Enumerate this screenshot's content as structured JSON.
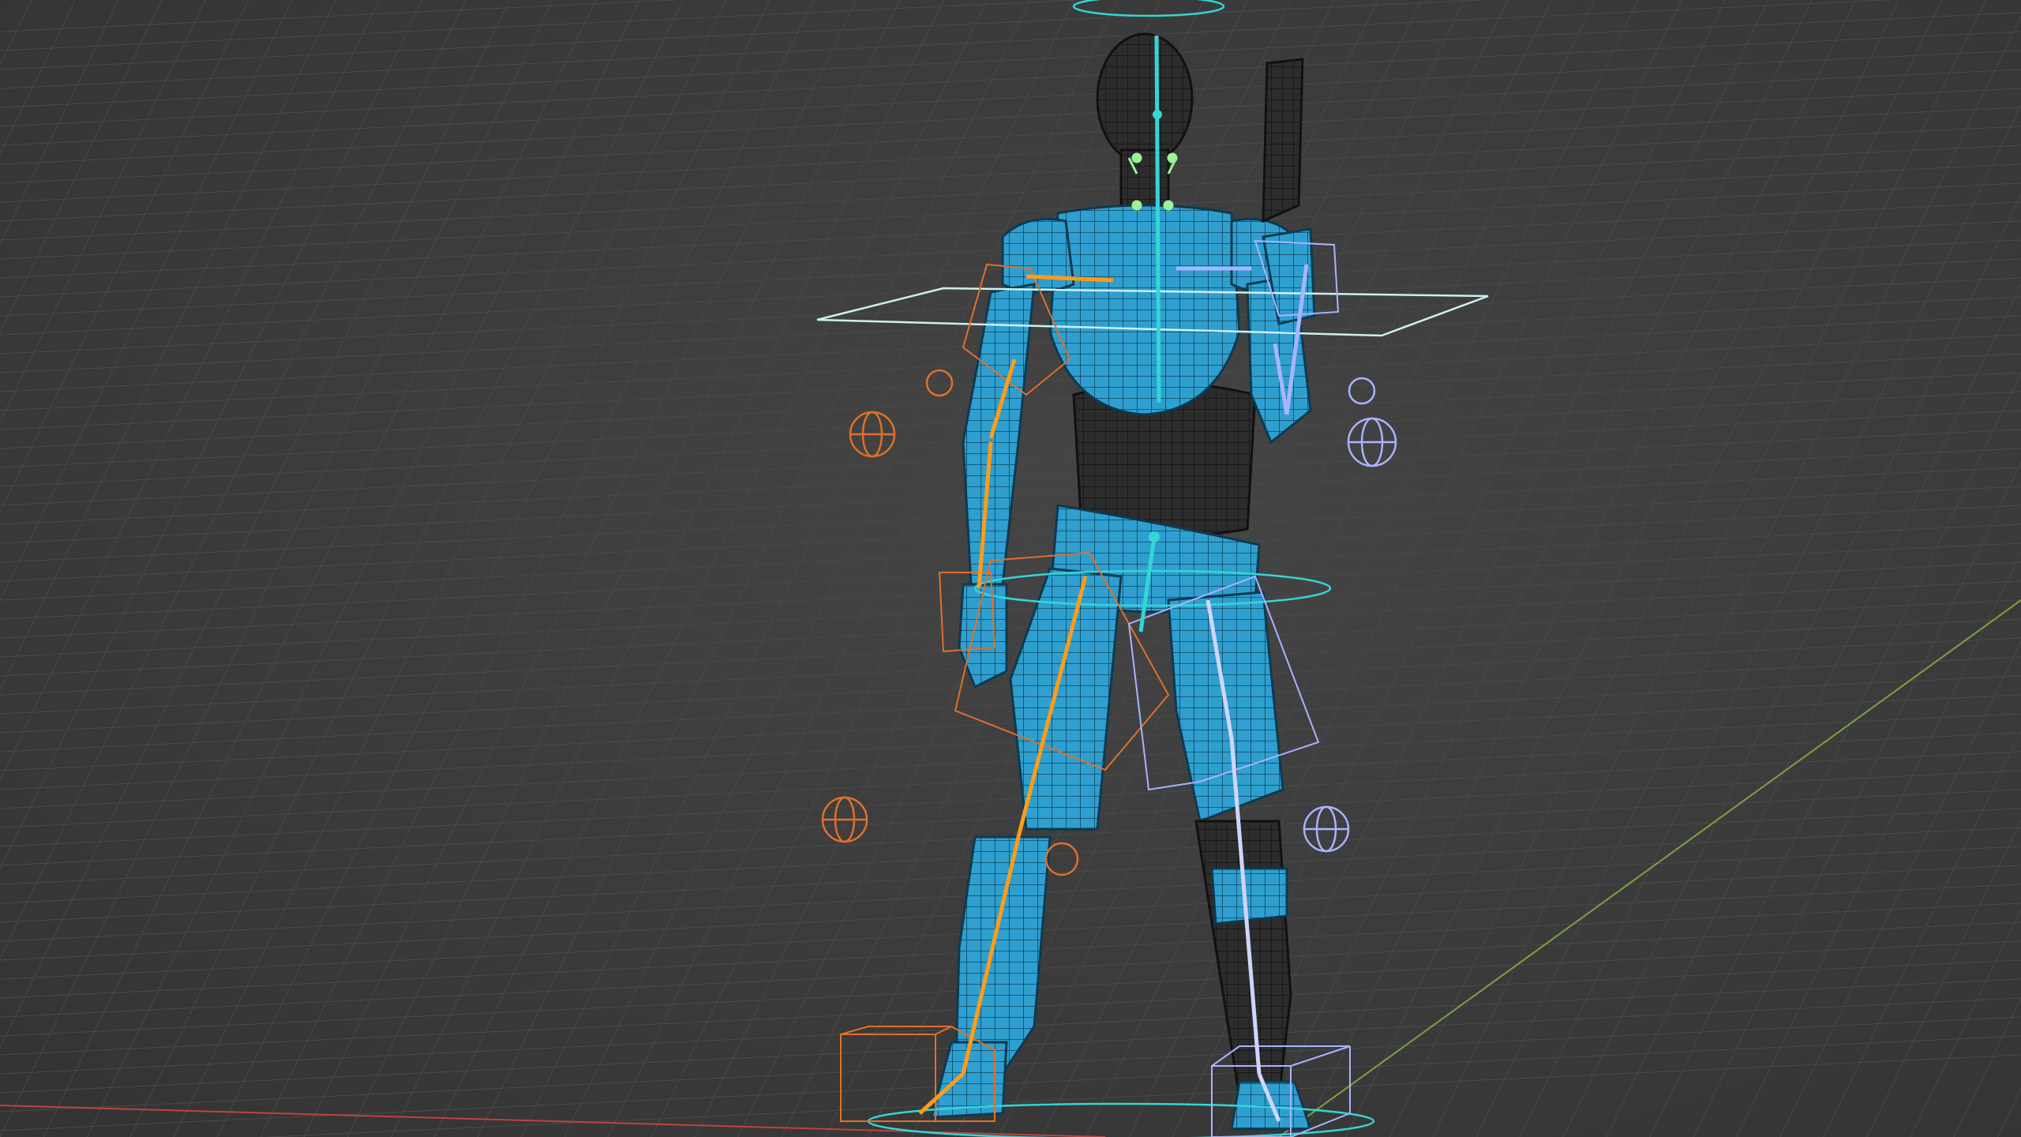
{
  "viewport": {
    "background": "#3a3a3a",
    "grid_color": "#4a4a4a",
    "axis_x_color": "#c0423f",
    "axis_y_color": "#7fa33a"
  },
  "model": {
    "mesh_color": "#2fa3d6",
    "body_color": "#2a2a2a"
  },
  "rig": {
    "center_bone_color": "#33d6d6",
    "left_side_color": "#e0702a",
    "right_side_color": "#a9b4ff",
    "bones": [
      "spine-bone",
      "neck-bone",
      "left-upper-arm-bone",
      "left-forearm-bone",
      "left-thigh-bone",
      "left-shin-bone",
      "right-upper-arm-bone",
      "right-forearm-bone",
      "right-thigh-bone",
      "right-shin-bone"
    ],
    "controls": [
      "chest-control-plane",
      "head-control-ring",
      "hip-control-ring",
      "root-control-ring",
      "left-elbow-pole-target",
      "left-knee-pole-target",
      "right-elbow-pole-target",
      "right-knee-pole-target",
      "left-foot-ik-cube",
      "right-foot-ik-cube"
    ]
  }
}
